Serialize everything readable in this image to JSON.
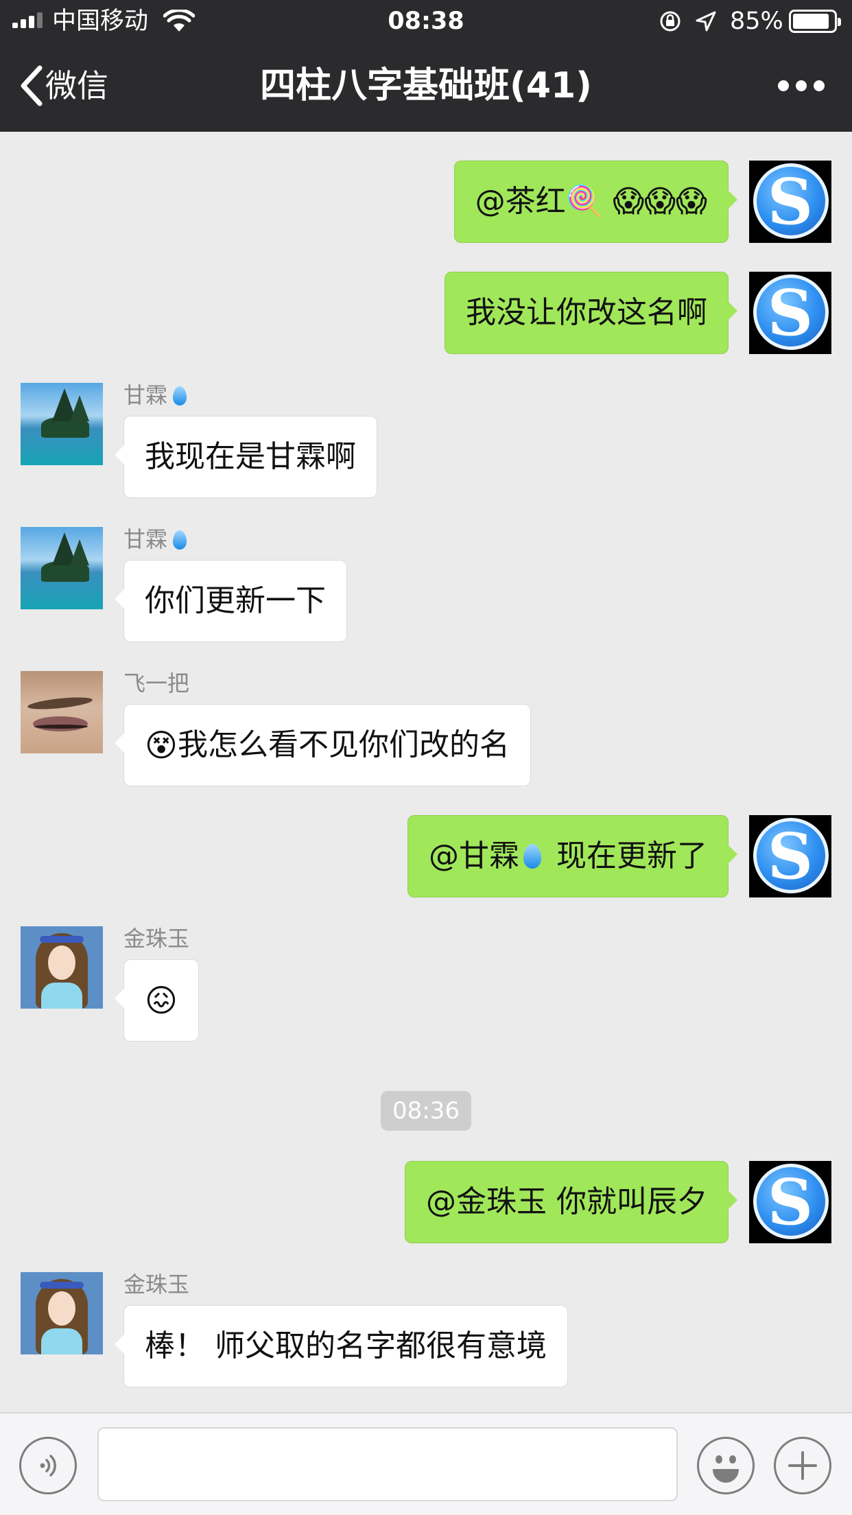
{
  "status_bar": {
    "carrier": "中国移动",
    "time": "08:38",
    "battery": "85%",
    "battery_level": 0.85
  },
  "nav": {
    "back_label": "微信",
    "title": "四柱八字基础班(41)"
  },
  "messages": [
    {
      "id": 1,
      "side": "out",
      "text": "@茶红🍭 😱😱😱"
    },
    {
      "id": 2,
      "side": "out",
      "text": "我没让你改这名啊"
    },
    {
      "id": 3,
      "side": "in",
      "sender": "甘霖",
      "text": "我现在是甘霖啊"
    },
    {
      "id": 4,
      "side": "in",
      "sender": "甘霖",
      "text": "你们更新一下"
    },
    {
      "id": 5,
      "side": "in",
      "sender": "飞一把",
      "text": "我怎么看不见你们改的名",
      "leading_emoji": "😵"
    },
    {
      "id": 6,
      "side": "out",
      "text_before": "@甘霖",
      "text_after": "现在更新了"
    },
    {
      "id": 7,
      "side": "in",
      "sender": "金珠玉",
      "text": "😖"
    },
    {
      "id": 8,
      "side": "out",
      "text": "@金珠玉 你就叫辰夕"
    },
    {
      "id": 9,
      "side": "in",
      "sender": "金珠玉",
      "text": "棒！ 师父取的名字都很有意境"
    }
  ],
  "time_divider": "08:36",
  "icons": {
    "wifi": "wifi-icon",
    "location": "location-arrow-icon",
    "lock": "orientation-lock-icon",
    "voice": "voice-icon",
    "emoji": "emoji-icon",
    "plus": "plus-icon",
    "more": "more-icon"
  }
}
